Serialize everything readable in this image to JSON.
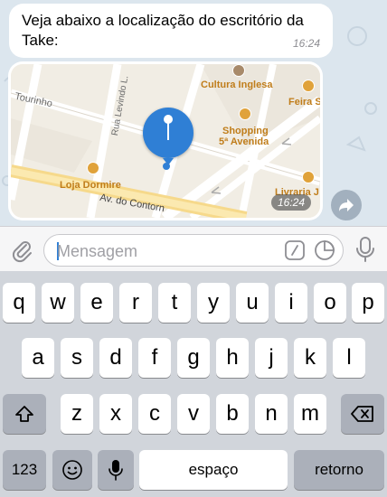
{
  "chat": {
    "text_message": {
      "text": "Veja abaixo a localização do escritório da Take:",
      "time": "16:24"
    },
    "location_message": {
      "time": "16:24",
      "map_labels": {
        "cultura": "Cultura Inglesa",
        "feira": "Feira Sh",
        "tourinho": "Tourinho",
        "levindo": "Rua Levindo L.",
        "shopping": "Shopping",
        "quinta_avenida": "5ª Avenida",
        "loja": "Loja Dormire",
        "avenida": "Av. do Contorn",
        "livraria": "Livraria J"
      }
    }
  },
  "input": {
    "placeholder": "Mensagem"
  },
  "keyboard": {
    "row1": [
      "q",
      "w",
      "e",
      "r",
      "t",
      "y",
      "u",
      "i",
      "o",
      "p"
    ],
    "row2": [
      "a",
      "s",
      "d",
      "f",
      "g",
      "h",
      "j",
      "k",
      "l"
    ],
    "row3": [
      "z",
      "x",
      "c",
      "v",
      "b",
      "n",
      "m"
    ],
    "numbers_label": "123",
    "space_label": "espaço",
    "return_label": "retorno"
  },
  "colors": {
    "accent": "#2f7fd5",
    "bubble": "#ffffff",
    "chat_bg": "#dce6ee",
    "keyboard_bg": "#d1d5db",
    "map_poi": "#e0a23a"
  }
}
